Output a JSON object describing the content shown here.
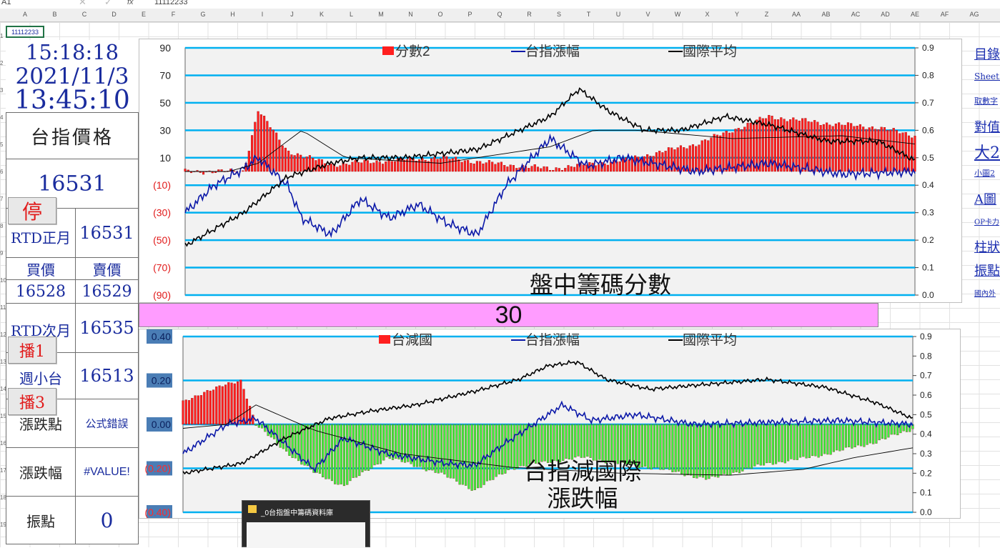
{
  "formula_bar": {
    "cell_ref": "A1",
    "formula": "11112233"
  },
  "columns": [
    "A",
    "B",
    "C",
    "D",
    "E",
    "F",
    "G",
    "H",
    "I",
    "J",
    "K",
    "L",
    "M",
    "N",
    "O",
    "P",
    "Q",
    "R",
    "S",
    "T",
    "U",
    "V",
    "W",
    "X",
    "Y",
    "Z",
    "AA",
    "AB",
    "AC",
    "AD",
    "AE",
    "AF",
    "AG"
  ],
  "rows": [
    "1",
    "2",
    "3",
    "4",
    "5",
    "6",
    "7",
    "8",
    "9",
    "10",
    "11",
    "12",
    "13",
    "14",
    "15",
    "16",
    "17",
    "18",
    "19"
  ],
  "left_panel": {
    "a1": "11112233",
    "time1": "15:18:18",
    "date": "2021/11/3",
    "time2": "13:45:10",
    "price_label": "台指價格",
    "price_value": "16531",
    "rtd_near_label": "RTD正月",
    "rtd_near_value": "16531",
    "buy_label": "買價",
    "sell_label": "賣價",
    "buy_value": "16528",
    "sell_value": "16529",
    "rtd_next_label": "RTD次月",
    "rtd_next_value": "16535",
    "weekly_label": "週小台",
    "weekly_value": "16513",
    "change_pts_label": "漲跌點",
    "change_pts_value": "公式錯誤",
    "change_pct_label": "漲跌幅",
    "change_pct_value": "#VALUE!",
    "amp_label": "振點",
    "amp_value": "0"
  },
  "buttons": {
    "stop": "停",
    "play1": "播1",
    "play3": "播3"
  },
  "banner_value": "30",
  "side_links": [
    "目錄",
    "Sheet1",
    "取數字",
    "對值",
    "大2",
    "小圖2",
    "A圖",
    "OP卡力",
    "柱狀",
    "振點",
    "國內外"
  ],
  "taskbar_title": "_0台指盤中籌碼資料庫",
  "colors": {
    "accent": "#1a2c9e",
    "red": "#e11a1a",
    "bar_red": "#ff1f1f",
    "bar_green": "#3cf03c",
    "gridline": "#00b0f0",
    "banner": "#ff9cff"
  },
  "chart_data": [
    {
      "type": "bar",
      "title": "盤中籌碼分數",
      "legend": [
        "分數2",
        "台指漲幅",
        "國際平均"
      ],
      "legend_placement": "top",
      "y_left_ticks": [
        "90",
        "70",
        "50",
        "30",
        "10",
        "(10)",
        "(30)",
        "(50)",
        "(70)",
        "(90)"
      ],
      "y_right_ticks": [
        "0.9",
        "0.8",
        "0.7",
        "0.6",
        "0.5",
        "0.4",
        "0.3",
        "0.2",
        "0.1",
        "0.0"
      ],
      "ylim_left": [
        -90,
        90
      ],
      "ylim_right": [
        0,
        0.9
      ],
      "grid": true,
      "series": [
        {
          "name": "分數2",
          "kind": "bar",
          "axis": "left",
          "x": [
            0,
            8,
            10,
            14,
            20,
            28,
            35,
            42,
            50,
            60,
            70,
            80,
            88,
            95,
            100
          ],
          "values": [
            0,
            0,
            45,
            15,
            5,
            8,
            10,
            6,
            2,
            8,
            20,
            40,
            35,
            32,
            26
          ]
        },
        {
          "name": "台指漲幅",
          "kind": "line",
          "axis": "right",
          "x": [
            0,
            4,
            8,
            10,
            14,
            16,
            20,
            24,
            28,
            32,
            36,
            40,
            44,
            50,
            55,
            60,
            70,
            80,
            90,
            100
          ],
          "values": [
            0.3,
            0.4,
            0.46,
            0.5,
            0.4,
            0.28,
            0.22,
            0.35,
            0.28,
            0.33,
            0.26,
            0.22,
            0.4,
            0.57,
            0.47,
            0.5,
            0.45,
            0.48,
            0.44,
            0.45
          ]
        },
        {
          "name": "國際平均",
          "kind": "line",
          "axis": "right",
          "x": [
            0,
            8,
            14,
            20,
            24,
            30,
            40,
            50,
            54,
            58,
            63,
            68,
            74,
            80,
            88,
            95,
            100
          ],
          "values": [
            0.18,
            0.3,
            0.43,
            0.48,
            0.5,
            0.5,
            0.53,
            0.65,
            0.75,
            0.67,
            0.6,
            0.6,
            0.65,
            0.62,
            0.56,
            0.56,
            0.49
          ]
        },
        {
          "name": "國際平均",
          "kind": "line",
          "axis": "right",
          "x": [
            0,
            6,
            10,
            16,
            22,
            35,
            50,
            56,
            62,
            75,
            90,
            100
          ],
          "values": [
            0.45,
            0.45,
            0.48,
            0.6,
            0.5,
            0.48,
            0.54,
            0.6,
            0.6,
            0.57,
            0.58,
            0.55
          ]
        }
      ]
    },
    {
      "type": "bar",
      "title": "台指減國際\n漲跌幅",
      "legend": [
        "台減國",
        "台指漲幅",
        "國際平均"
      ],
      "legend_placement": "top",
      "y_left_ticks": [
        "0.40",
        "0.20",
        "0.00",
        "(0.20)",
        "(0.40)"
      ],
      "y_right_ticks": [
        "0.9",
        "0.8",
        "0.7",
        "0.6",
        "0.5",
        "0.4",
        "0.3",
        "0.2",
        "0.1",
        "0.0"
      ],
      "ylim_left": [
        -0.4,
        0.4
      ],
      "ylim_right": [
        0,
        0.9
      ],
      "grid": true,
      "series": [
        {
          "name": "台減國",
          "kind": "bar",
          "axis": "left",
          "x": [
            0,
            3,
            6,
            8,
            10,
            14,
            18,
            22,
            28,
            35,
            40,
            45,
            50,
            55,
            60,
            65,
            72,
            80,
            86,
            90,
            95,
            100
          ],
          "values": [
            0.1,
            0.15,
            0.18,
            0.2,
            0,
            -0.12,
            -0.22,
            -0.28,
            -0.15,
            -0.22,
            -0.3,
            -0.2,
            -0.17,
            -0.15,
            -0.18,
            -0.2,
            -0.25,
            -0.18,
            -0.15,
            -0.12,
            -0.08,
            -0.02
          ]
        },
        {
          "name": "台指漲幅",
          "kind": "line",
          "axis": "right",
          "x": [
            0,
            6,
            10,
            14,
            18,
            22,
            28,
            36,
            40,
            44,
            48,
            52,
            56,
            62,
            70,
            80,
            90,
            100
          ],
          "values": [
            0.3,
            0.45,
            0.48,
            0.35,
            0.22,
            0.38,
            0.3,
            0.25,
            0.24,
            0.35,
            0.45,
            0.55,
            0.47,
            0.5,
            0.45,
            0.46,
            0.47,
            0.45
          ]
        },
        {
          "name": "國際平均",
          "kind": "line",
          "axis": "right",
          "x": [
            0,
            8,
            14,
            20,
            26,
            32,
            40,
            46,
            50,
            54,
            58,
            64,
            70,
            80,
            88,
            95,
            100
          ],
          "values": [
            0.2,
            0.25,
            0.38,
            0.48,
            0.52,
            0.55,
            0.62,
            0.68,
            0.75,
            0.77,
            0.68,
            0.63,
            0.65,
            0.68,
            0.64,
            0.56,
            0.48
          ]
        },
        {
          "name": "國際平均",
          "kind": "line",
          "axis": "right",
          "x": [
            0,
            6,
            10,
            18,
            30,
            45,
            60,
            75,
            85,
            92,
            100
          ],
          "values": [
            0.43,
            0.45,
            0.55,
            0.42,
            0.3,
            0.23,
            0.2,
            0.19,
            0.22,
            0.28,
            0.33
          ]
        }
      ]
    }
  ]
}
